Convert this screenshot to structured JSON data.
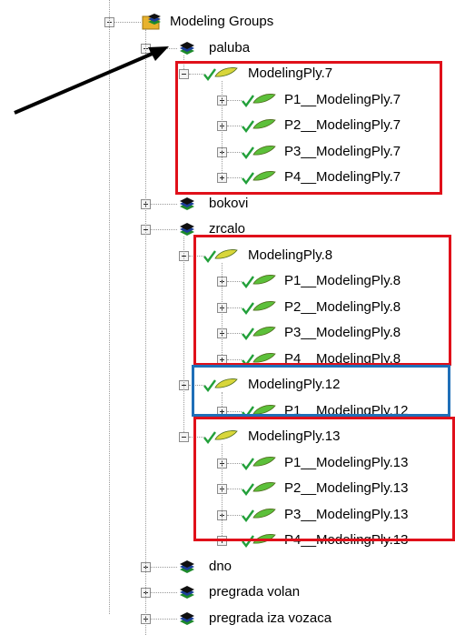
{
  "tree": {
    "root": {
      "label": "Modeling Groups",
      "icon": "folder-layers-icon"
    },
    "groups": [
      {
        "label": "paluba",
        "icon": "layers-icon",
        "expanded": true,
        "plies": [
          {
            "label": "ModelingPly.7",
            "children": [
              "P1__ModelingPly.7",
              "P2__ModelingPly.7",
              "P3__ModelingPly.7",
              "P4__ModelingPly.7"
            ]
          }
        ]
      },
      {
        "label": "bokovi",
        "icon": "layers-icon",
        "expanded": false
      },
      {
        "label": "zrcalo",
        "icon": "layers-icon",
        "expanded": true,
        "plies": [
          {
            "label": "ModelingPly.8",
            "children": [
              "P1__ModelingPly.8",
              "P2__ModelingPly.8",
              "P3__ModelingPly.8",
              "P4__ModelingPly.8"
            ]
          },
          {
            "label": "ModelingPly.12",
            "children": [
              "P1__ModelingPly.12"
            ]
          },
          {
            "label": "ModelingPly.13",
            "children": [
              "P1__ModelingPly.13",
              "P2__ModelingPly.13",
              "P3__ModelingPly.13",
              "P4__ModelingPly.13"
            ]
          }
        ]
      },
      {
        "label": "dno",
        "icon": "layers-icon",
        "expanded": false
      },
      {
        "label": "pregrada volan",
        "icon": "layers-icon",
        "expanded": false
      },
      {
        "label": "pregrada iza vozaca",
        "icon": "layers-icon",
        "expanded": false
      }
    ]
  },
  "colors": {
    "highlight_red": "#e0101a",
    "highlight_blue": "#1f6fb8",
    "arrow": "#000000"
  }
}
